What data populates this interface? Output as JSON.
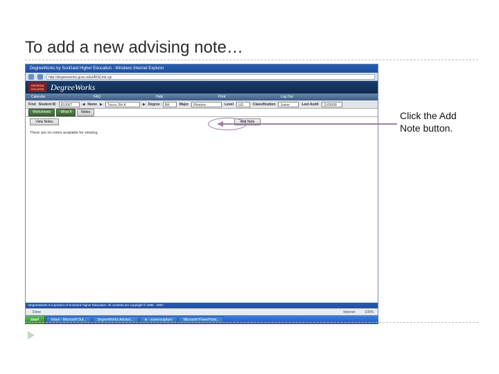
{
  "slide": {
    "title": "To add a new advising note…",
    "callout": "Click the Add Note button."
  },
  "ie": {
    "title": "DegreeWorks by SunGard Higher Education - Windows Internet Explorer",
    "url": "http://degreeworks.gcsu.edu/IRISLink.cgi",
    "status_zone": "Internet",
    "zoom": "100%",
    "done": "Done"
  },
  "dw": {
    "logo_text": "GEORGIA COLLEGE",
    "app_title": "DegreeWorks",
    "nav": {
      "calendar": "Calendar",
      "faq": "FAQ",
      "help": "Help",
      "print": "Print",
      "logout": "Log Out"
    },
    "student": {
      "find_label": "Find",
      "id_label": "Student ID",
      "id_value": "810007",
      "arrow_left": "◀",
      "name_label": "Name",
      "arrow_right": "▶",
      "name_value": "Tucco, Bri A",
      "arrow_right2": "▶",
      "degree_label": "Degree",
      "degree_value": "BA",
      "major_label": "Major",
      "major_value": "Rhetoric",
      "level_label": "Level",
      "level_value": "UG",
      "class_label": "Classification",
      "class_value": "Junior",
      "last_audit_label": "Last Audit",
      "last_audit_value": "11/06/08"
    },
    "tabs": {
      "worksheets": "Worksheets",
      "whatif": "What If",
      "notes": "Notes"
    },
    "sidebar": {
      "view_notes": "View Notes"
    },
    "body": {
      "add_note": "Add Note",
      "no_notes": "There are no notes available for viewing."
    },
    "footer": "DegreeWorks is a product of SunGard Higher Education. All contents are copyright © 1996 - 2007."
  },
  "taskbar": {
    "start": "start",
    "items": [
      "Inbox - Microsoft Out...",
      "DegreeWorks Advisor...",
      "ie - screencapture",
      "Microsoft PowerPoint..."
    ]
  }
}
